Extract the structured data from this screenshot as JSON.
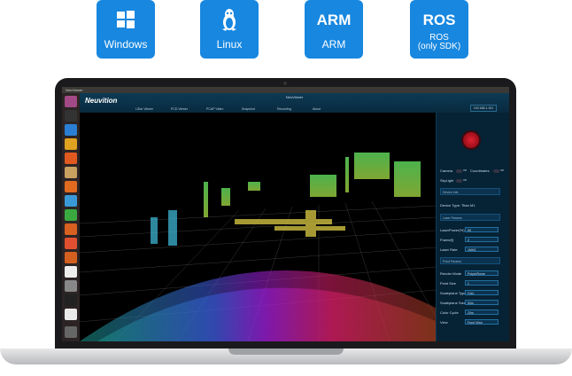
{
  "platforms": [
    {
      "name": "Windows",
      "label": "Windows"
    },
    {
      "name": "Linux",
      "label": "Linux"
    },
    {
      "name": "ARM",
      "title": "ARM",
      "label": "ARM"
    },
    {
      "name": "ROS",
      "title": "ROS",
      "label": "ROS",
      "sub": "(only SDK)"
    }
  ],
  "colors": {
    "badge": "#1787e0",
    "panel": "#062235",
    "record": "#e02030"
  },
  "screen": {
    "os_title": "NeuViewer",
    "app_logo": "Neuvition",
    "app_title": "NeuViewer",
    "tabs": [
      "LiDar Viewer",
      "PCD Viewer",
      "PCAP Video",
      "Snapshot",
      "Recording",
      "About"
    ],
    "ip": "192.168.1.101",
    "panel": {
      "camera_label": "Camera",
      "coordinate_label": "Coordinates",
      "skylight_label": "SkyLight",
      "off": "Off",
      "device_info": "Device Info",
      "device_type": "Device Type: Titan M1",
      "laser_params": "Laser Params",
      "laser_power_label": "LaserPower(%)",
      "laser_power_value": "50",
      "frame_label": "Frame(f)",
      "frame_value": "2",
      "laser_rate_label": "Laser Rate",
      "laser_rate_value": "1MHZ",
      "point_params": "Point Params",
      "render_mode_label": "Render Mode",
      "render_mode_value": "PolychRome",
      "point_size_label": "Point Size",
      "point_size_value": "1",
      "scaleplane_type_label": "Scaleplane Type",
      "scaleplane_type_value": "Grid",
      "scaleplane_size_label": "Scaleplane Size",
      "scaleplane_size_value": "50m",
      "color_cycle_label": "Color Cycle",
      "color_cycle_value": "20m",
      "view_label": "View",
      "view_value": "Front View"
    }
  }
}
